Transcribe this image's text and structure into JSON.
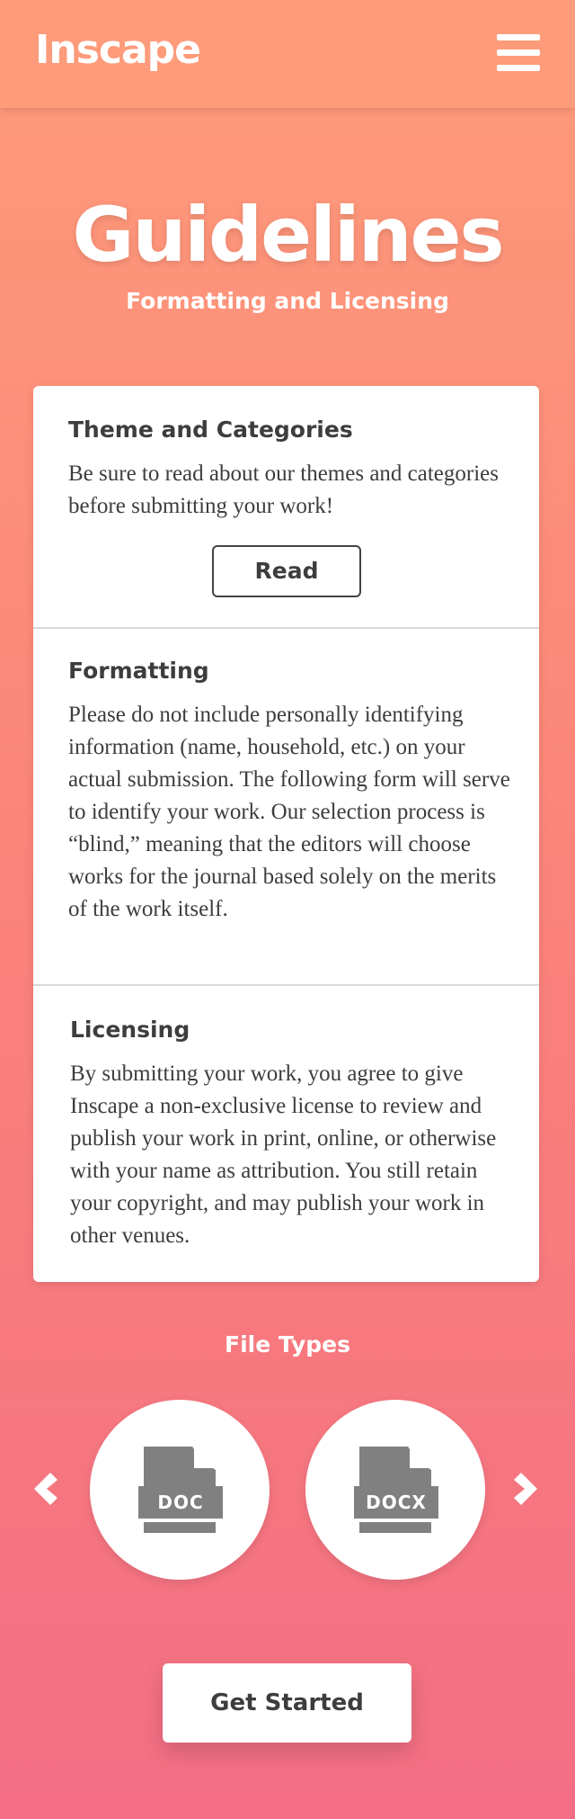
{
  "header": {
    "brand": "Inscape",
    "menu_icon": "hamburger-menu-icon"
  },
  "hero": {
    "title": "Guidelines",
    "subtitle": "Formatting and Licensing"
  },
  "sections": [
    {
      "title": "Theme and Categories",
      "body": "Be sure to read about our themes and categories before submitting your work!",
      "button": "Read"
    },
    {
      "title": "Formatting",
      "body": "Please do not include personally identifying information (name, household, etc.) on your actual submission. The following form will serve to identify your work. Our selection process is “blind,” meaning that the editors will choose works for the journal based solely on the merits of the work itself."
    },
    {
      "title": "Licensing",
      "body": "By submitting your work, you agree to give Inscape a non-exclusive license to review and publish your work in print, online, or otherwise with your name as attribution. You still retain your copyright, and may publish your work in other venues."
    }
  ],
  "file_types": {
    "title": "File Types",
    "items": [
      {
        "label": "DOC",
        "icon": "file-icon"
      },
      {
        "label": "DOCX",
        "icon": "file-icon"
      }
    ],
    "prev_icon": "chevron-left-icon",
    "next_icon": "chevron-right-icon"
  },
  "cta": {
    "label": "Get Started"
  },
  "colors": {
    "gradient_top": "#fe9b7a",
    "gradient_bottom": "#f36e84",
    "text_dark": "#3d3d3d",
    "icon_gray": "#808080"
  }
}
